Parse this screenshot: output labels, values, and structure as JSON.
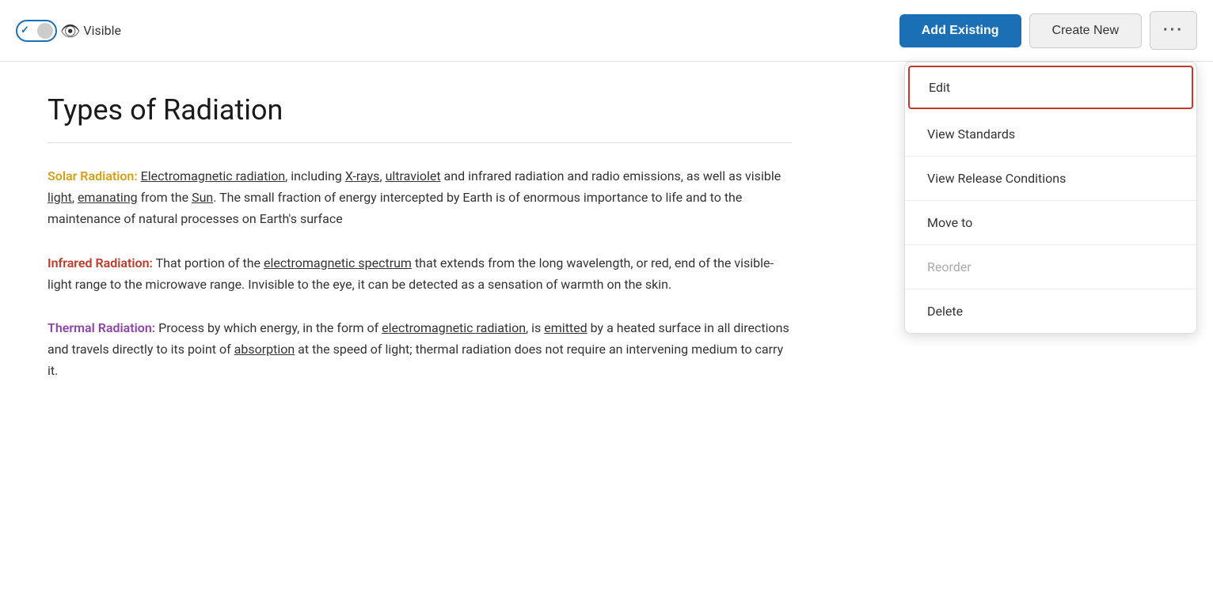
{
  "toolbar": {
    "visible_label": "Visible",
    "add_existing_label": "Add Existing",
    "create_new_label": "Create New",
    "more_label": "···"
  },
  "dropdown": {
    "edit_label": "Edit",
    "view_standards_label": "View Standards",
    "view_release_conditions_label": "View Release Conditions",
    "move_to_label": "Move to",
    "reorder_label": "Reorder",
    "delete_label": "Delete"
  },
  "content": {
    "title": "Types of Radiation",
    "solar_label": "Solar Radiation:",
    "solar_text": " Electromagnetic radiation, including X-rays, ultraviolet and infrared radiation and radio emissions, as well as visible light, emanating from the Sun. The small fraction of energy intercepted by Earth is of enormous importance to life and to the maintenance of natural processes on Earth's surface",
    "infrared_label": "Infrared Radiation:",
    "infrared_text": " That portion of the electromagnetic spectrum that extends from the long wavelength, or red, end of the visible-light range to the microwave range. Invisible to the eye, it can be detected as a sensation of warmth on the skin.",
    "thermal_label": "Thermal Radiation:",
    "thermal_text": " Process by which energy, in the form of electromagnetic radiation, is emitted by a heated surface in all directions and travels directly to its point of absorption at the speed of light; thermal radiation does not require an intervening medium to carry it."
  }
}
